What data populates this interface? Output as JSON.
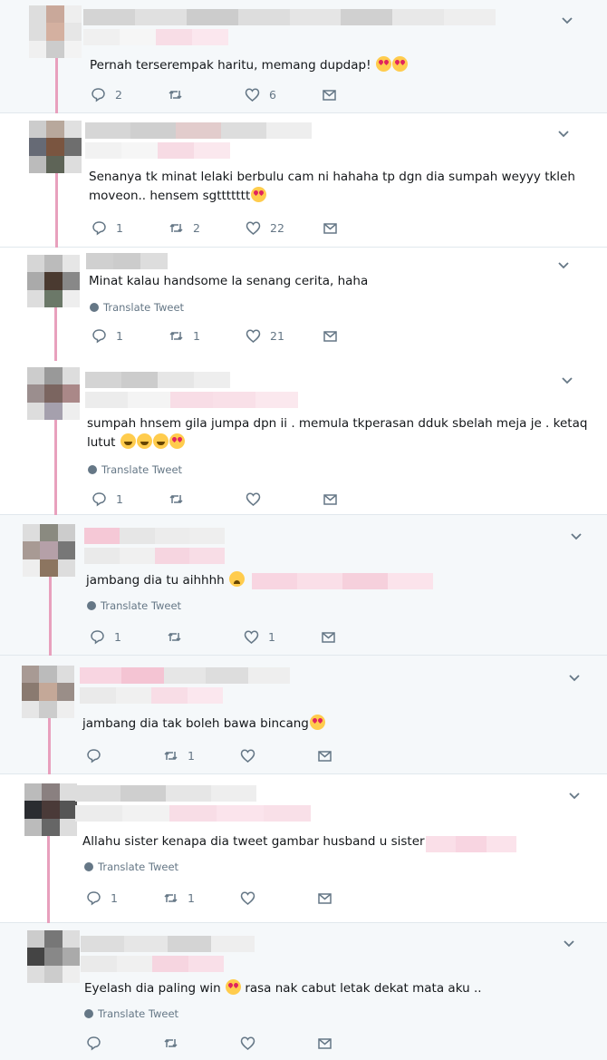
{
  "tweets": [
    {
      "text": "Pernah terserempak haritu, memang dupdap!",
      "emoji": [
        "love",
        "love"
      ],
      "translate": "",
      "reply": "2",
      "retweet": "",
      "like": "6"
    },
    {
      "text": "Senanya tk minat lelaki berbulu cam ni hahaha tp dgn dia sumpah weyyy tkleh",
      "text2": "moveon.. hensem sgttttttt",
      "emoji": [
        "love"
      ],
      "translate": "",
      "reply": "1",
      "retweet": "2",
      "like": "22"
    },
    {
      "text": "Minat kalau handsome la senang cerita, haha",
      "emoji": [],
      "translate": "Translate Tweet",
      "reply": "1",
      "retweet": "1",
      "like": "21"
    },
    {
      "text": "sumpah hnsem gila jumpa dpn ii . memula tkperasan dduk sbelah meja je . ketaq",
      "text2": "lutut",
      "emoji": [
        "laugh",
        "laugh",
        "laugh",
        "love"
      ],
      "translate": "Translate Tweet",
      "reply": "1",
      "retweet": "",
      "like": ""
    },
    {
      "text": "jambang dia tu aihhhh",
      "emoji": [
        "cry"
      ],
      "translate": "Translate Tweet",
      "reply": "1",
      "retweet": "",
      "like": "1"
    },
    {
      "text": "jambang dia tak boleh bawa bincang",
      "emoji": [
        "love"
      ],
      "translate": "",
      "reply": "",
      "retweet": "1",
      "like": ""
    },
    {
      "text": "Allahu sister kenapa dia tweet gambar husband u sister",
      "emoji": [],
      "translate": "Translate Tweet",
      "reply": "1",
      "retweet": "1",
      "like": ""
    },
    {
      "text": "Eyelash dia paling win",
      "text_after": "rasa nak cabut letak dekat mata aku ..",
      "emoji": [
        "love"
      ],
      "translate": "Translate Tweet",
      "reply": "",
      "retweet": "",
      "like": ""
    }
  ],
  "icons": [
    "reply-icon",
    "retweet-icon",
    "like-icon",
    "dm-icon",
    "chevron-down-icon",
    "globe-icon"
  ],
  "colors": {
    "thread": "#e8a0bd",
    "muted": "#657786",
    "shaded_bg": "#f5f8fa"
  }
}
